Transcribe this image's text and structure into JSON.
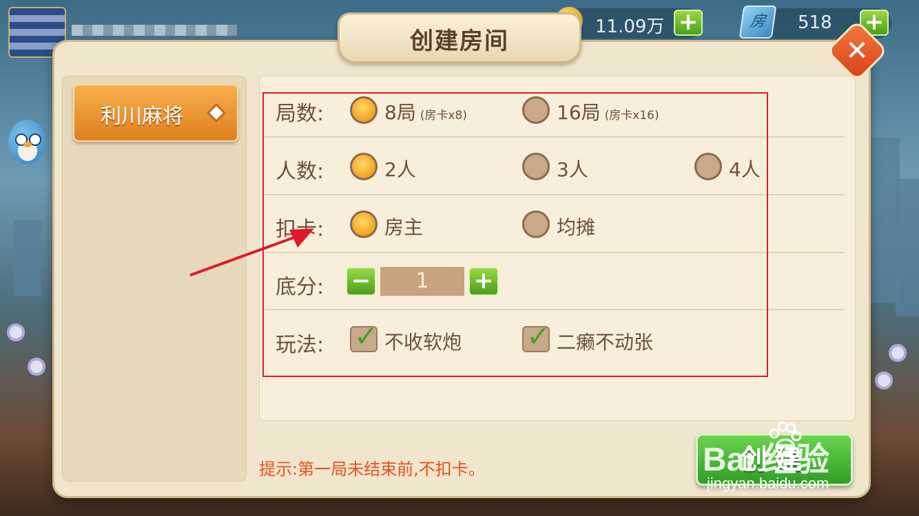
{
  "top_bar": {
    "coins": "11.09万",
    "room_cards": "518",
    "card_icon_glyph": "房"
  },
  "dialog": {
    "title": "创建房间",
    "close_glyph": "✕",
    "game_tab": "利川麻将",
    "rows": {
      "rounds": {
        "label": "局数:",
        "options": [
          {
            "text": "8局",
            "sub": "(房卡x8)",
            "selected": true
          },
          {
            "text": "16局",
            "sub": "(房卡x16)",
            "selected": false
          }
        ]
      },
      "players": {
        "label": "人数:",
        "options": [
          {
            "text": "2人",
            "selected": true
          },
          {
            "text": "3人",
            "selected": false
          },
          {
            "text": "4人",
            "selected": false
          }
        ]
      },
      "card_deduction": {
        "label": "扣卡:",
        "options": [
          {
            "text": "房主",
            "selected": true
          },
          {
            "text": "均摊",
            "selected": false
          }
        ]
      },
      "base_score": {
        "label": "底分:",
        "value": "1",
        "minus_glyph": "−",
        "plus_glyph": "+"
      },
      "play_rules": {
        "label": "玩法:",
        "options": [
          {
            "text": "不收软炮",
            "checked": true
          },
          {
            "text": "二癞不动张",
            "checked": true
          }
        ]
      }
    },
    "hint": "提示:第一局未结束前,不扣卡。",
    "create_button": "创建"
  },
  "watermark": {
    "brand": "Bai 经验",
    "url": "jingyan.baidu.com"
  },
  "colors": {
    "accent_orange": "#f3a21e",
    "highlight_red": "#e0192b",
    "button_green": "#4b9f1c",
    "hint_text": "#e2541b"
  }
}
